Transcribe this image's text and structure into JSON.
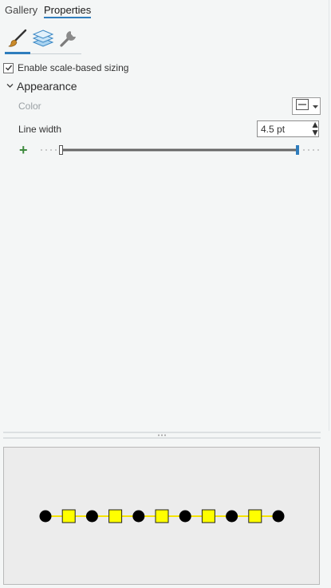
{
  "tabs": [
    {
      "label": "Gallery",
      "active": false
    },
    {
      "label": "Properties",
      "active": true
    }
  ],
  "ribbon": {
    "buttons": [
      {
        "icon": "paintbrush-icon",
        "selected": true
      },
      {
        "icon": "layers-icon",
        "selected": false
      },
      {
        "icon": "wrench-icon",
        "selected": false
      }
    ]
  },
  "scale_sizing": {
    "label": "Enable scale-based sizing",
    "checked": true
  },
  "appearance": {
    "title": "Appearance",
    "expanded": true,
    "color": {
      "label": "Color",
      "value_icon": "no-color-icon"
    },
    "line_width": {
      "label": "Line width",
      "value": "4.5 pt"
    },
    "slider": {
      "min_fraction": 0.0,
      "max_fraction": 1.0
    }
  },
  "preview": {
    "line_color": "#f5e300",
    "dot_color": "#000000",
    "square_fill": "#ffff00",
    "pattern": [
      "dot",
      "square",
      "dot",
      "square",
      "dot",
      "square",
      "dot",
      "square",
      "dot",
      "square",
      "dot"
    ]
  },
  "colors": {
    "accent": "#2f7dbd",
    "add_green": "#3d8a3d"
  }
}
